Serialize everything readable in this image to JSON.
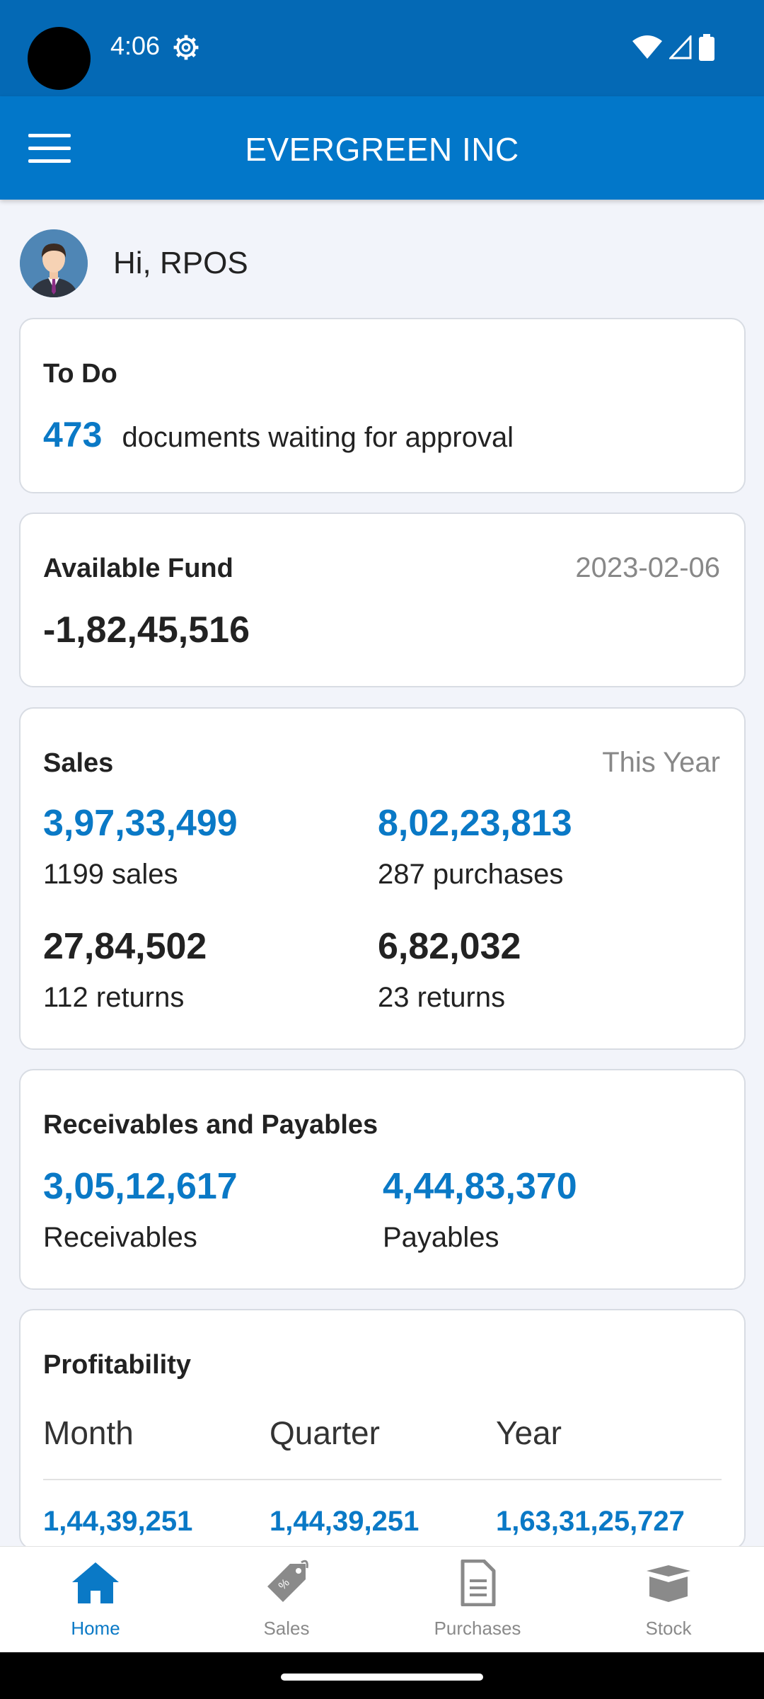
{
  "status_bar": {
    "time": "4:06"
  },
  "app_bar": {
    "title": "EVERGREEN INC"
  },
  "greeting": {
    "text": "Hi, RPOS"
  },
  "todo": {
    "title": "To Do",
    "count": "473",
    "text": "documents waiting for approval"
  },
  "fund": {
    "title": "Available Fund",
    "date": "2023-02-06",
    "amount": "-1,82,45,516"
  },
  "sales": {
    "title": "Sales",
    "period": "This Year",
    "sales_amount": "3,97,33,499",
    "sales_count": "1199 sales",
    "purchase_amount": "8,02,23,813",
    "purchase_count": "287 purchases",
    "sales_return_amount": "27,84,502",
    "sales_return_count": "112 returns",
    "purchase_return_amount": "6,82,032",
    "purchase_return_count": "23 returns"
  },
  "recpay": {
    "title": "Receivables and Payables",
    "receivables_amount": "3,05,12,617",
    "receivables_label": "Receivables",
    "payables_amount": "4,44,83,370",
    "payables_label": "Payables"
  },
  "profit": {
    "title": "Profitability",
    "columns": [
      "Month",
      "Quarter",
      "Year"
    ],
    "values": [
      "1,44,39,251",
      "1,44,39,251",
      "1,63,31,25,727"
    ]
  },
  "nav": {
    "items": [
      {
        "label": "Home",
        "icon": "home-icon"
      },
      {
        "label": "Sales",
        "icon": "tag-icon"
      },
      {
        "label": "Purchases",
        "icon": "document-icon"
      },
      {
        "label": "Stock",
        "icon": "box-icon"
      }
    ],
    "active_color": "#0a79c6",
    "inactive_color": "#8a8a8a"
  },
  "colors": {
    "primary": "#0277c9",
    "status_bar": "#0469b5",
    "accent": "#0a79c6"
  }
}
